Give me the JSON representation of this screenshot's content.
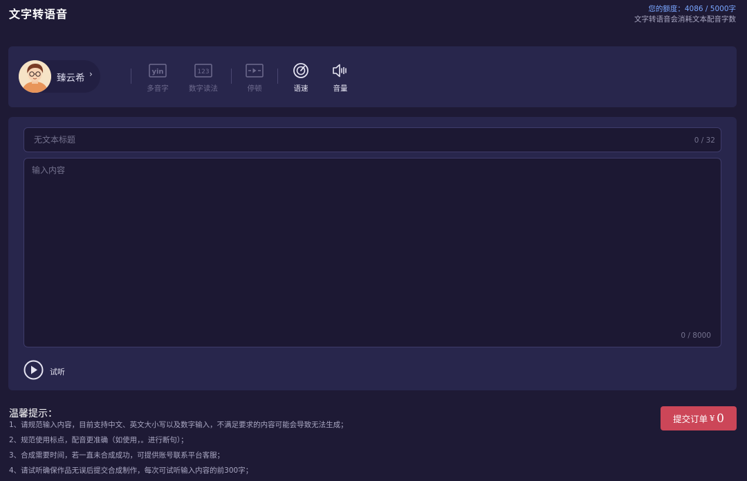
{
  "header": {
    "title": "文字转语音",
    "quota_line": "您的额度：4086 / 5000字",
    "quota_note": "文字转语音会消耗文本配音字数"
  },
  "voice": {
    "name": "臻云希",
    "chevron": "›"
  },
  "tools": [
    {
      "label": "多音字",
      "icon": "yin-icon",
      "enabled": false
    },
    {
      "label": "数字读法",
      "icon": "number-123-icon",
      "enabled": false
    },
    {
      "label": "停顿",
      "icon": "pause-insert-icon",
      "enabled": false
    },
    {
      "label": "语速",
      "icon": "speed-gauge-icon",
      "enabled": true
    },
    {
      "label": "音量",
      "icon": "volume-icon",
      "enabled": true
    }
  ],
  "editor": {
    "title_placeholder": "无文本标题",
    "title_count": "0 / 32",
    "content_placeholder": "输入内容",
    "content_count": "0 / 8000",
    "listen_label": "试听"
  },
  "tips": {
    "title": "温馨提示：",
    "items": [
      "1、请规范输入内容，目前支持中文、英文大小写以及数字输入，不满足要求的内容可能会导致无法生成；",
      "2、规范使用标点，配音更准确（如使用，。进行断句）；",
      "3、合成需要时间，若一直未合成成功，可提供账号联系平台客服；",
      "4、请试听确保作品无误后提交合成制作，每次可试听输入内容的前300字；"
    ]
  },
  "submit": {
    "label": "提交订单",
    "currency": "¥",
    "amount": "0"
  },
  "colors": {
    "background": "#1e1a35",
    "card": "#28264c",
    "input": "#1c1833",
    "accent_blue": "#7aa6ff",
    "submit_red": "#cc4658"
  }
}
